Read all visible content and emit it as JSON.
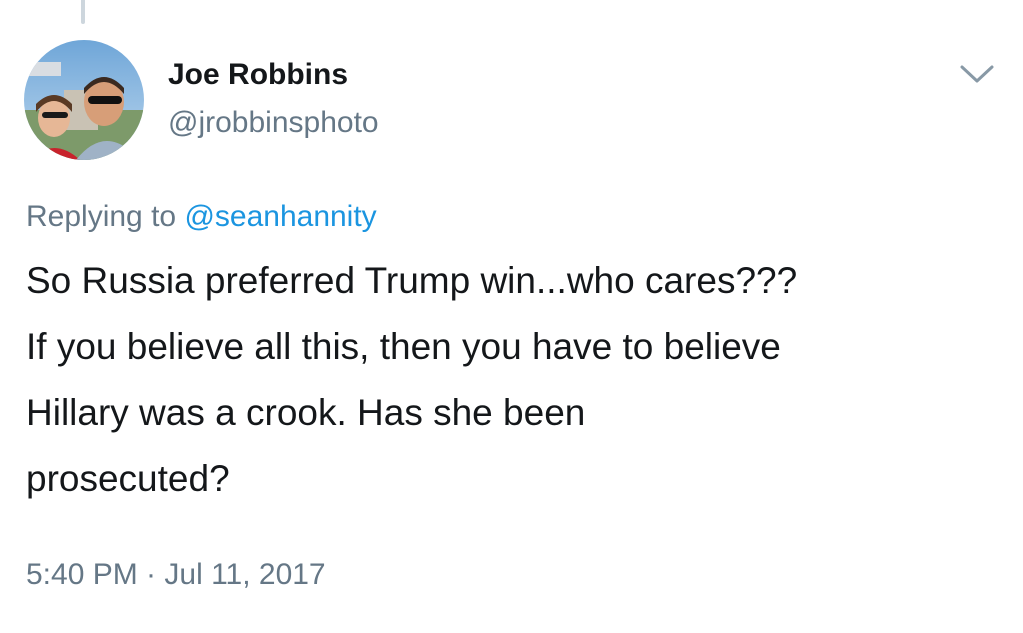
{
  "tweet": {
    "display_name": "Joe Robbins",
    "handle": "@jrobbinsphoto",
    "replying_prefix": "Replying to",
    "replying_to": "@seanhannity",
    "text": "So Russia preferred Trump win...who cares???\nIf you believe all this, then you have to believe\nHillary was a crook. Has she been\nprosecuted?",
    "timestamp": "5:40 PM · Jul 11, 2017"
  },
  "icons": {
    "menu": "chevron-down-icon",
    "avatar": "profile-photo"
  },
  "colors": {
    "text_primary": "#14171a",
    "text_secondary": "#657786",
    "link": "#1b95e0",
    "thread_line": "#cdd6dd"
  }
}
